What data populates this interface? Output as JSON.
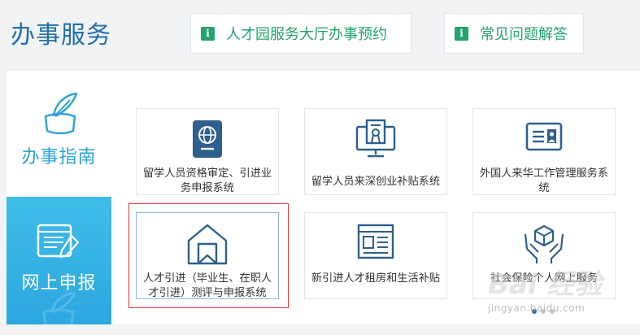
{
  "header": {
    "title": "办事服务",
    "badge_glyph": "i",
    "appointment_label": "人才园服务大厅办事预约",
    "faq_label": "常见问题解答"
  },
  "sidebar": {
    "guide_label": "办事指南",
    "report_label": "网上申报"
  },
  "services": [
    {
      "label": "留学人员资格审定、引进业务申报系统",
      "icon": "passport-icon"
    },
    {
      "label": "留学人员来深创业补贴系统",
      "icon": "monitor-certificate-icon"
    },
    {
      "label": "外国人来华工作管理服务系统",
      "icon": "id-card-icon"
    },
    {
      "label": "人才引进（毕业生、在职人才引进）测评与申报系统",
      "icon": "house-bookmark-icon"
    },
    {
      "label": "新引进人才租房和生活补贴",
      "icon": "web-layout-icon"
    },
    {
      "label": "社会保险个人网上服务",
      "icon": "hands-cube-icon"
    }
  ],
  "watermark": {
    "brand": "Bai 经验",
    "url": "jingyan.baidu.com"
  },
  "colors": {
    "title_blue": "#1f6fae",
    "accent_green": "#23a36c",
    "sidebar_blue": "#2ca7e0",
    "icon_blue": "#2e5f8e",
    "highlight_red": "#d7393a"
  },
  "pager": {
    "total": 3,
    "current": 1
  }
}
